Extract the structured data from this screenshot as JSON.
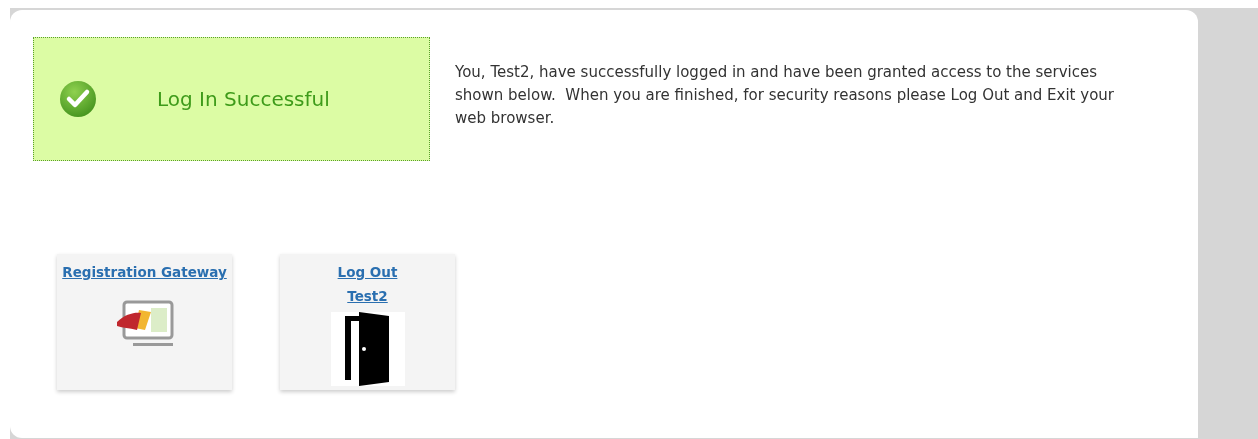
{
  "banner": {
    "message": "Log In Successful"
  },
  "welcome_text": "You, Test2, have successfully logged in and have been granted access to the services shown below.  When you are finished, for security reasons please Log Out and Exit your web browser.",
  "tiles": [
    {
      "kind": "gateway",
      "links": [
        "Registration Gateway"
      ]
    },
    {
      "kind": "logout",
      "links": [
        "Log Out",
        "Test2"
      ]
    }
  ]
}
